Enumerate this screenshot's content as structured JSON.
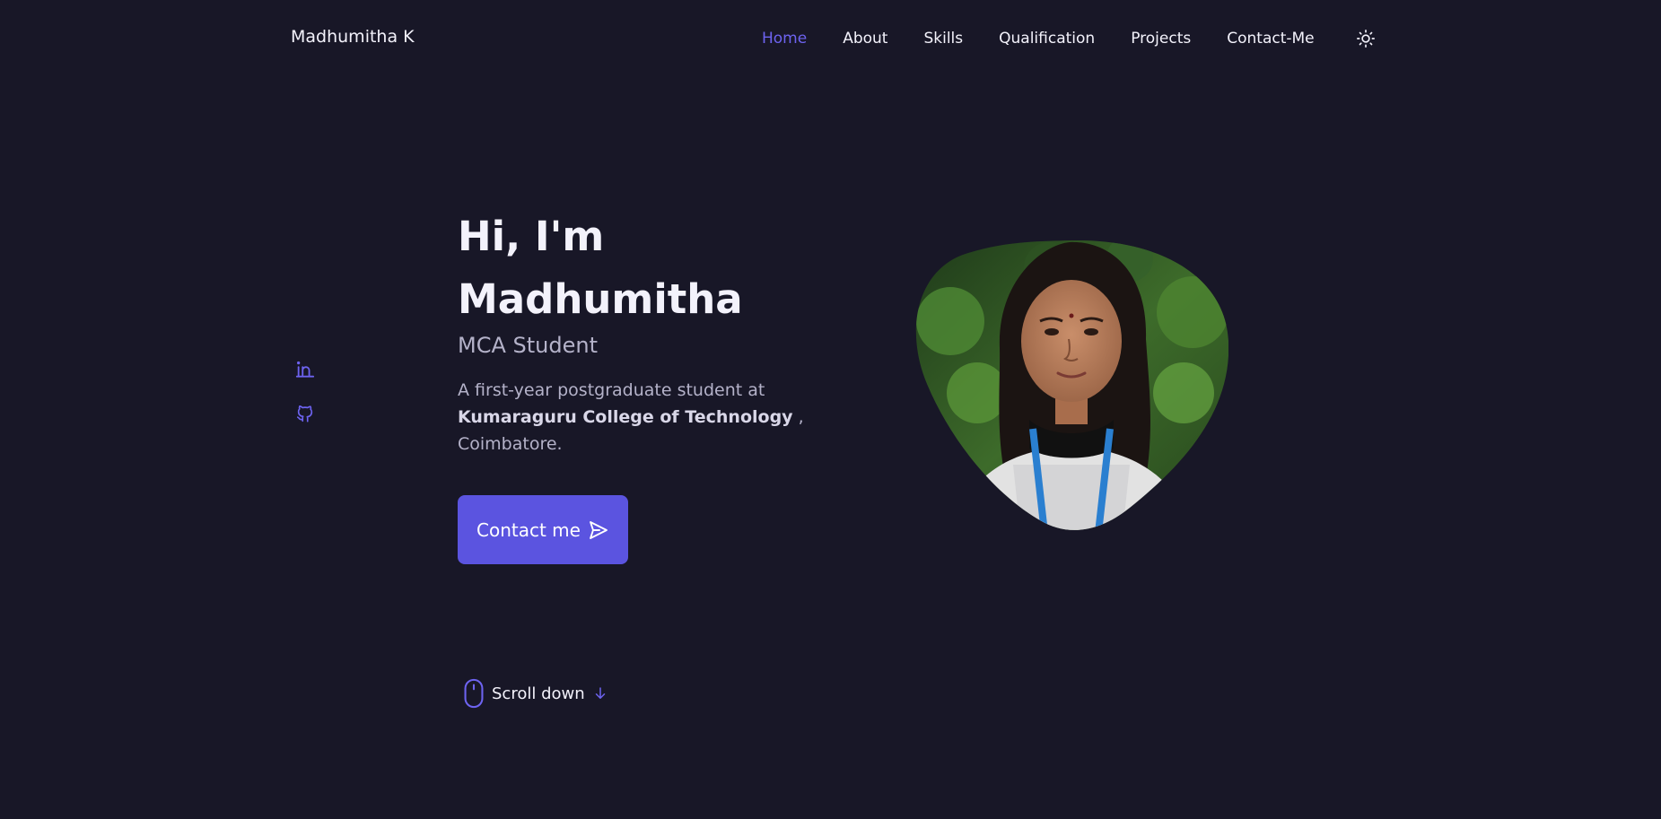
{
  "header": {
    "brand": "Madhumitha K",
    "nav": [
      {
        "label": "Home",
        "active": true
      },
      {
        "label": "About",
        "active": false
      },
      {
        "label": "Skills",
        "active": false
      },
      {
        "label": "Qualification",
        "active": false
      },
      {
        "label": "Projects",
        "active": false
      },
      {
        "label": "Contact-Me",
        "active": false
      }
    ],
    "theme_icon": "sun-icon"
  },
  "social": [
    {
      "icon": "linkedin-icon"
    },
    {
      "icon": "github-icon"
    }
  ],
  "hero": {
    "greeting": "Hi, I'm",
    "name": "Madhumitha",
    "subtitle": "MCA Student",
    "desc_prefix": "A first-year postgraduate student at ",
    "desc_college": "Kumaraguru College of Technology",
    "desc_suffix": " , Coimbatore.",
    "contact_label": "Contact me",
    "contact_icon": "send-icon"
  },
  "scroll": {
    "label": "Scroll down",
    "mouse_icon": "mouse-icon",
    "arrow_icon": "arrow-down-icon"
  },
  "colors": {
    "background": "#181727",
    "accent": "#5b54e0",
    "accent_light": "#6d63f0",
    "text": "#f3f2fb",
    "muted": "#b4b2c9"
  }
}
